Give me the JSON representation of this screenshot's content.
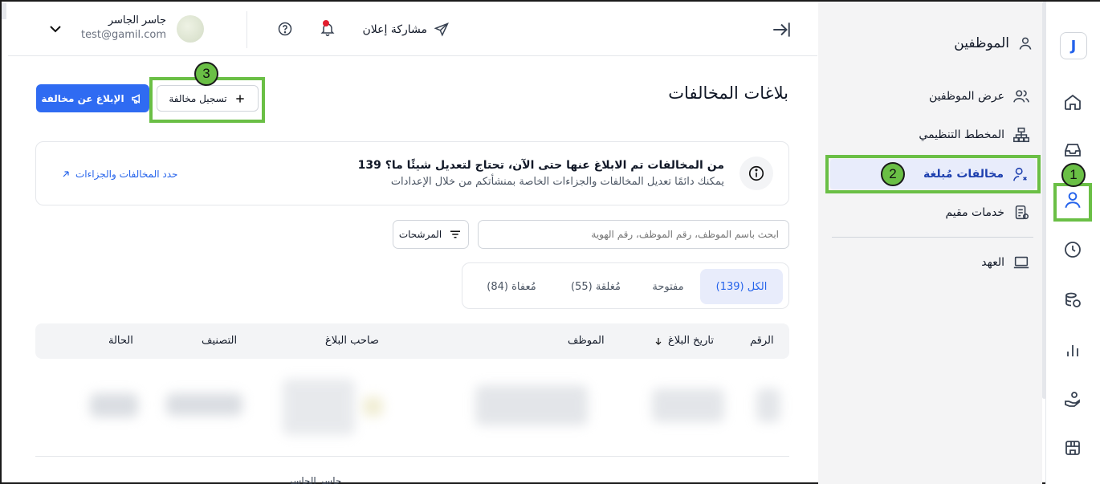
{
  "header": {
    "user_name": "جاسر الجاسر",
    "user_email": "test@gamil.com",
    "share_label": "مشاركة إعلان"
  },
  "sidebar": {
    "title": "الموظفين",
    "items": [
      {
        "label": "عرض الموظفين",
        "icon": "users-icon"
      },
      {
        "label": "المخطط التنظيمي",
        "icon": "org-chart-icon"
      },
      {
        "label": "مخالفات مُبلغة",
        "icon": "user-x-icon",
        "active": true
      },
      {
        "label": "خدمات مقيم",
        "icon": "document-icon"
      },
      {
        "label": "العهد",
        "icon": "laptop-icon"
      }
    ]
  },
  "annotations": {
    "badge1": "1",
    "badge2": "2",
    "badge3": "3"
  },
  "page": {
    "title": "بلاغات المخالفات",
    "report_button": "الإبلاغ عن مخالفة",
    "register_button": "تسجيل مخالفة"
  },
  "banner": {
    "title": "139 من المخالفات تم الابلاغ عنها حتى الآن، تحتاج لتعديل شيئًا ما؟",
    "subtitle": "يمكنك دائمًا تعديل المخالفات والجزاءات الخاصة بمنشأتكم من خلال الإعدادات",
    "link": "حدد المخالفات والجزاءات"
  },
  "search": {
    "placeholder": "ابحث باسم الموظف، رقم الموظف، رقم الهوية",
    "filters_label": "المرشحات"
  },
  "tabs": [
    {
      "label": "الكل (139)",
      "active": true
    },
    {
      "label": "مفتوحة"
    },
    {
      "label": "مُغلقة (55)"
    },
    {
      "label": "مُعفاة (84)"
    }
  ],
  "table": {
    "columns": [
      "الرقم",
      "تاريخ البلاغ",
      "الموظف",
      "صاحب البلاغ",
      "التصنيف",
      "الحالة"
    ],
    "partial_text": "جاسر الجاسر"
  },
  "colors": {
    "primary": "#2f6bf2",
    "highlight": "#6abf45",
    "notification": "#e11d2e"
  }
}
